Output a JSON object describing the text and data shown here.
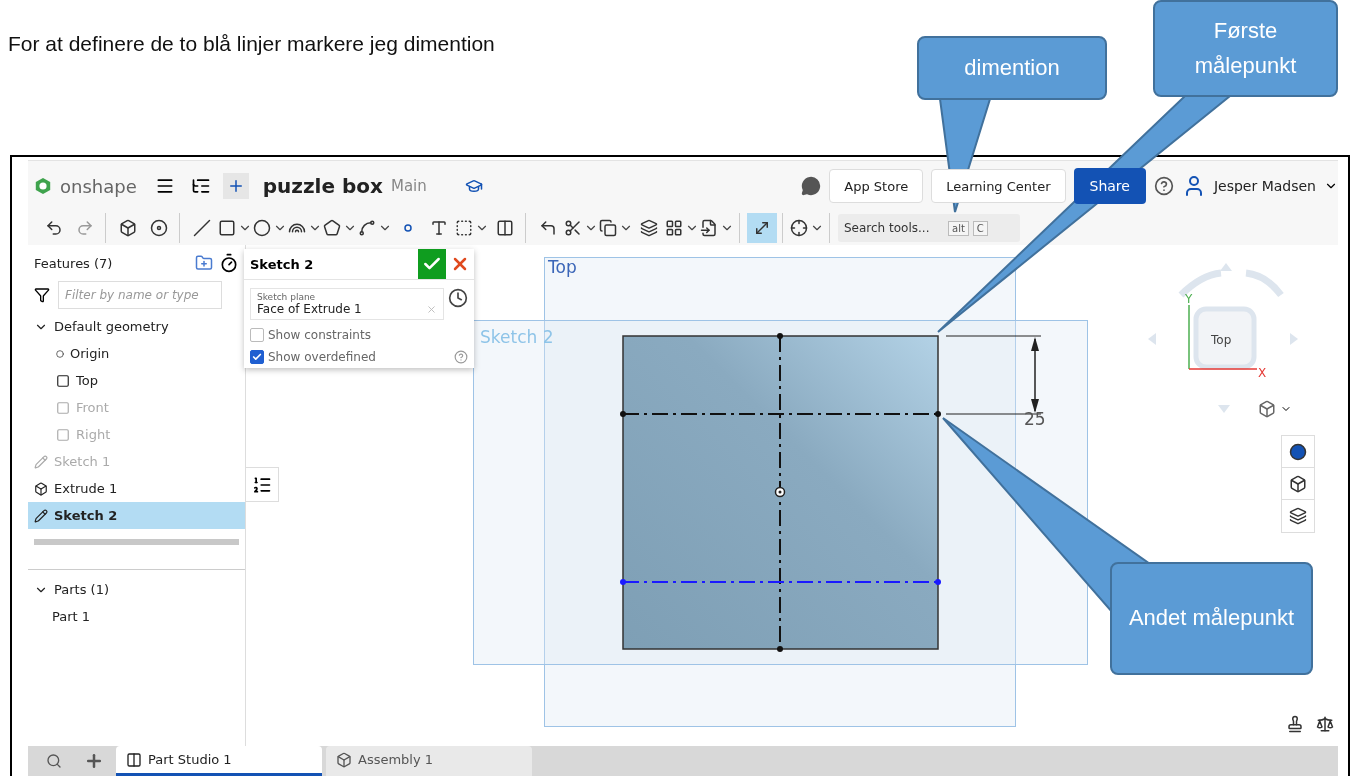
{
  "caption": "For at definere de to blå linjer markere jeg dimention",
  "callouts": [
    {
      "text": "dimention"
    },
    {
      "text": "Første målepunkt"
    },
    {
      "text": "Andet målepunkt"
    }
  ],
  "header": {
    "brand": "onshape",
    "document": "puzzle box",
    "branch": "Main",
    "buttons": [
      "App Store",
      "Learning Center"
    ],
    "share": "Share",
    "user": "Jesper Madsen"
  },
  "tool_groups": [
    [
      {
        "kind": "undo",
        "menu": false,
        "active": false
      },
      {
        "kind": "redo",
        "menu": false,
        "active": false
      }
    ],
    [
      {
        "kind": "extrude",
        "menu": false,
        "active": false
      },
      {
        "kind": "revolve",
        "menu": false,
        "active": false
      }
    ],
    [
      {
        "kind": "line",
        "menu": false,
        "active": false
      },
      {
        "kind": "rectangle",
        "menu": true,
        "active": false
      },
      {
        "kind": "circle",
        "menu": true,
        "active": false
      },
      {
        "kind": "arc",
        "menu": true,
        "active": false
      },
      {
        "kind": "polygon",
        "menu": true,
        "active": false
      },
      {
        "kind": "spline",
        "menu": true,
        "active": false
      },
      {
        "kind": "point",
        "menu": false,
        "active": false
      },
      {
        "kind": "text",
        "menu": false,
        "active": false
      },
      {
        "kind": "construction",
        "menu": true,
        "active": false
      },
      {
        "kind": "mirror",
        "menu": false,
        "active": false
      }
    ],
    [
      {
        "kind": "fillet",
        "menu": false,
        "active": false
      },
      {
        "kind": "trim",
        "menu": true,
        "active": false
      },
      {
        "kind": "offset",
        "menu": true,
        "active": false
      },
      {
        "kind": "use",
        "menu": false,
        "active": false
      },
      {
        "kind": "pattern",
        "menu": true,
        "active": false
      },
      {
        "kind": "dxf",
        "menu": true,
        "active": false
      }
    ],
    [
      {
        "kind": "dimension",
        "menu": false,
        "active": true
      }
    ],
    [
      {
        "kind": "intersect",
        "menu": true,
        "active": false
      }
    ]
  ],
  "search": {
    "placeholder": "Search tools...",
    "keys": [
      "alt",
      "C"
    ]
  },
  "features": {
    "title": "Features (7)",
    "filter_placeholder": "Filter by name or type",
    "items": [
      {
        "label": "Default geometry",
        "kind": "group",
        "expanded": true,
        "disabled": false,
        "selected": false,
        "children": [
          {
            "label": "Origin",
            "kind": "origin",
            "disabled": false,
            "selected": false
          },
          {
            "label": "Top",
            "kind": "plane",
            "disabled": false,
            "selected": false
          },
          {
            "label": "Front",
            "kind": "plane",
            "disabled": true,
            "selected": false
          },
          {
            "label": "Right",
            "kind": "plane",
            "disabled": true,
            "selected": false
          }
        ]
      },
      {
        "label": "Sketch 1",
        "kind": "sketch",
        "disabled": true,
        "selected": false
      },
      {
        "label": "Extrude 1",
        "kind": "extrude",
        "disabled": false,
        "selected": false
      },
      {
        "label": "Sketch 2",
        "kind": "sketch",
        "disabled": false,
        "selected": true
      }
    ],
    "parts": {
      "label": "Parts (1)",
      "expanded": true,
      "children": [
        {
          "label": "Part 1"
        }
      ]
    }
  },
  "sketch_dialog": {
    "title": "Sketch 2",
    "plane_label": "Sketch plane",
    "plane_value": "Face of Extrude 1",
    "options": [
      {
        "label": "Show constraints",
        "checked": false
      },
      {
        "label": "Show overdefined",
        "checked": true
      }
    ]
  },
  "canvas": {
    "plane_label": "Top",
    "sketch_label": "Sketch 2",
    "dimension": "25"
  },
  "view_cube": {
    "face": "Top",
    "y_axis": "Y",
    "x_axis": "X"
  },
  "tabs": [
    {
      "label": "Part Studio 1",
      "kind": "part_studio",
      "selected": true
    },
    {
      "label": "Assembly 1",
      "kind": "assembly",
      "selected": false
    }
  ]
}
